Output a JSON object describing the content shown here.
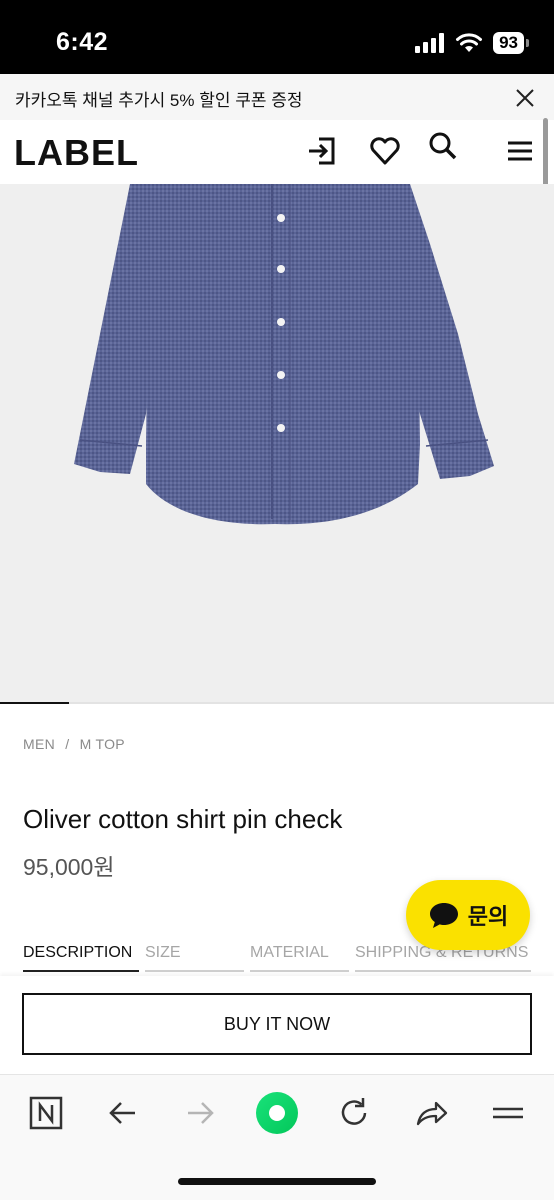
{
  "status": {
    "time": "6:42",
    "battery": "93"
  },
  "promo": {
    "text": "카카오톡 채널 추가시 5% 할인 쿠폰 증정"
  },
  "header": {
    "logo": "LABEL"
  },
  "breadcrumb": {
    "items": [
      "MEN",
      "/",
      "M TOP"
    ]
  },
  "product": {
    "name": "Oliver cotton shirt pin check",
    "price": "95,000원"
  },
  "image_carousel": {
    "progress": 0.125
  },
  "tabs": [
    {
      "label": "DESCRIPTION",
      "active": true
    },
    {
      "label": "SIZE",
      "active": false
    },
    {
      "label": "MATERIAL",
      "active": false
    },
    {
      "label": "SHIPPING & RETURNS",
      "active": false
    }
  ],
  "chat": {
    "label": "문의"
  },
  "buy": {
    "label": "BUY IT NOW"
  },
  "colors": {
    "kakao_yellow": "#fae100",
    "naver_green": "#03c75a",
    "shirt": "#5a6496"
  }
}
